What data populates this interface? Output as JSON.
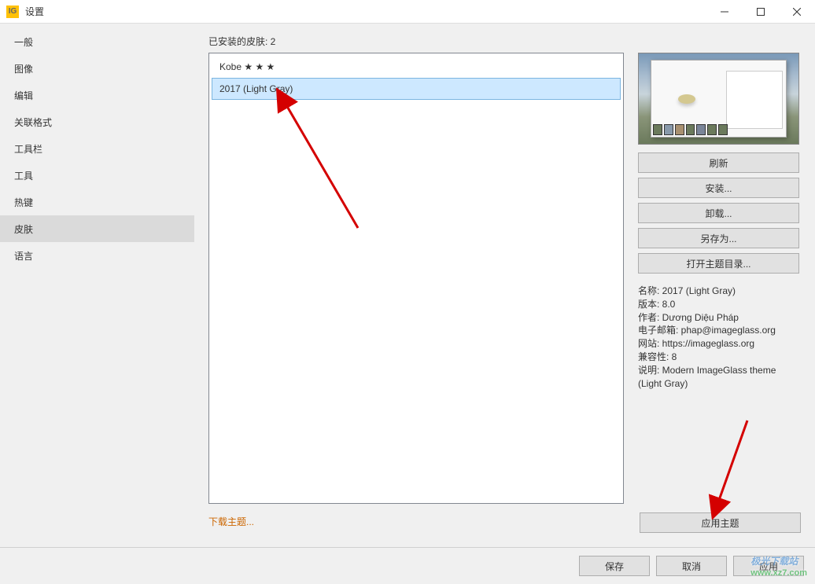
{
  "window": {
    "icon_text": "IG",
    "title": "设置"
  },
  "sidebar": {
    "items": [
      "一般",
      "图像",
      "编辑",
      "关联格式",
      "工具栏",
      "工具",
      "热键",
      "皮肤",
      "语言"
    ],
    "selected_index": 7
  },
  "main": {
    "installed_label": "已安装的皮肤: 2",
    "skins": [
      {
        "label": "Kobe ★ ★ ★"
      },
      {
        "label": "2017 (Light Gray)"
      }
    ],
    "selected_skin_index": 1,
    "download_link": "下载主题..."
  },
  "side_buttons": {
    "refresh": "刷新",
    "install": "安装...",
    "uninstall": "卸载...",
    "save_as": "另存为...",
    "open_dir": "打开主题目录..."
  },
  "details": {
    "name_label": "名称: ",
    "name_value": "2017 (Light Gray)",
    "version_label": "版本: ",
    "version_value": "8.0",
    "author_label": "作者: ",
    "author_value": "Dương Diệu Pháp",
    "email_label": "电子邮箱: ",
    "email_value": "phap@imageglass.org",
    "website_label": "网站: ",
    "website_value": "https://imageglass.org",
    "compat_label": "兼容性: ",
    "compat_value": "8",
    "desc_label": "说明: ",
    "desc_value": "Modern ImageGlass theme (Light Gray)"
  },
  "apply_theme": "应用主题",
  "footer": {
    "save": "保存",
    "cancel": "取消",
    "apply": "应用"
  },
  "watermark": {
    "line1": "极光下载站",
    "line2": "www.xz7.com"
  }
}
